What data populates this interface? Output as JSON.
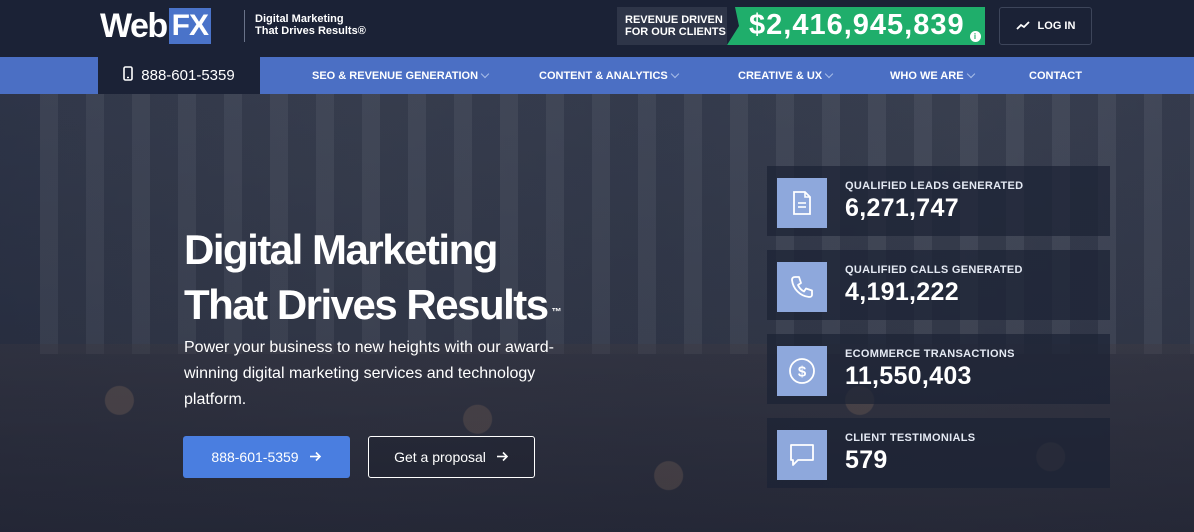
{
  "header": {
    "logo_web": "Web",
    "logo_fx": "FX",
    "tagline_line1": "Digital Marketing",
    "tagline_line2": "That Drives Results®",
    "revenue_label_line1": "REVENUE DRIVEN",
    "revenue_label_line2": "FOR OUR CLIENTS",
    "revenue_amount": "$2,416,945,839",
    "revenue_info_icon": "info-icon",
    "login_label": "LOG IN",
    "login_icon": "trend-up-icon"
  },
  "nav": {
    "phone": "888-601-5359",
    "phone_icon": "mobile-phone-icon",
    "items": [
      {
        "label": "SEO & REVENUE GENERATION",
        "has_dropdown": true
      },
      {
        "label": "CONTENT & ANALYTICS",
        "has_dropdown": true
      },
      {
        "label": "CREATIVE & UX",
        "has_dropdown": true
      },
      {
        "label": "WHO WE ARE",
        "has_dropdown": true
      },
      {
        "label": "CONTACT",
        "has_dropdown": false
      }
    ]
  },
  "hero": {
    "headline_line1": "Digital Marketing",
    "headline_line2": "That Drives Results",
    "trademark": "™",
    "subtext": "Power your business to new heights with our award-winning digital marketing services and technology platform.",
    "call_button": "888-601-5359",
    "proposal_button": "Get a proposal"
  },
  "stats": [
    {
      "label": "QUALIFIED LEADS GENERATED",
      "value": "6,271,747",
      "icon": "document-icon"
    },
    {
      "label": "QUALIFIED CALLS GENERATED",
      "value": "4,191,222",
      "icon": "phone-icon"
    },
    {
      "label": "ECOMMERCE TRANSACTIONS",
      "value": "11,550,403",
      "icon": "dollar-icon"
    },
    {
      "label": "CLIENT TESTIMONIALS",
      "value": "579",
      "icon": "chat-icon"
    }
  ],
  "colors": {
    "dark_navy": "#1b2236",
    "nav_blue": "#4b6fc4",
    "accent_green": "#1fae6b",
    "button_blue": "#4a7ee0",
    "icon_tile": "#8ea8dc"
  }
}
